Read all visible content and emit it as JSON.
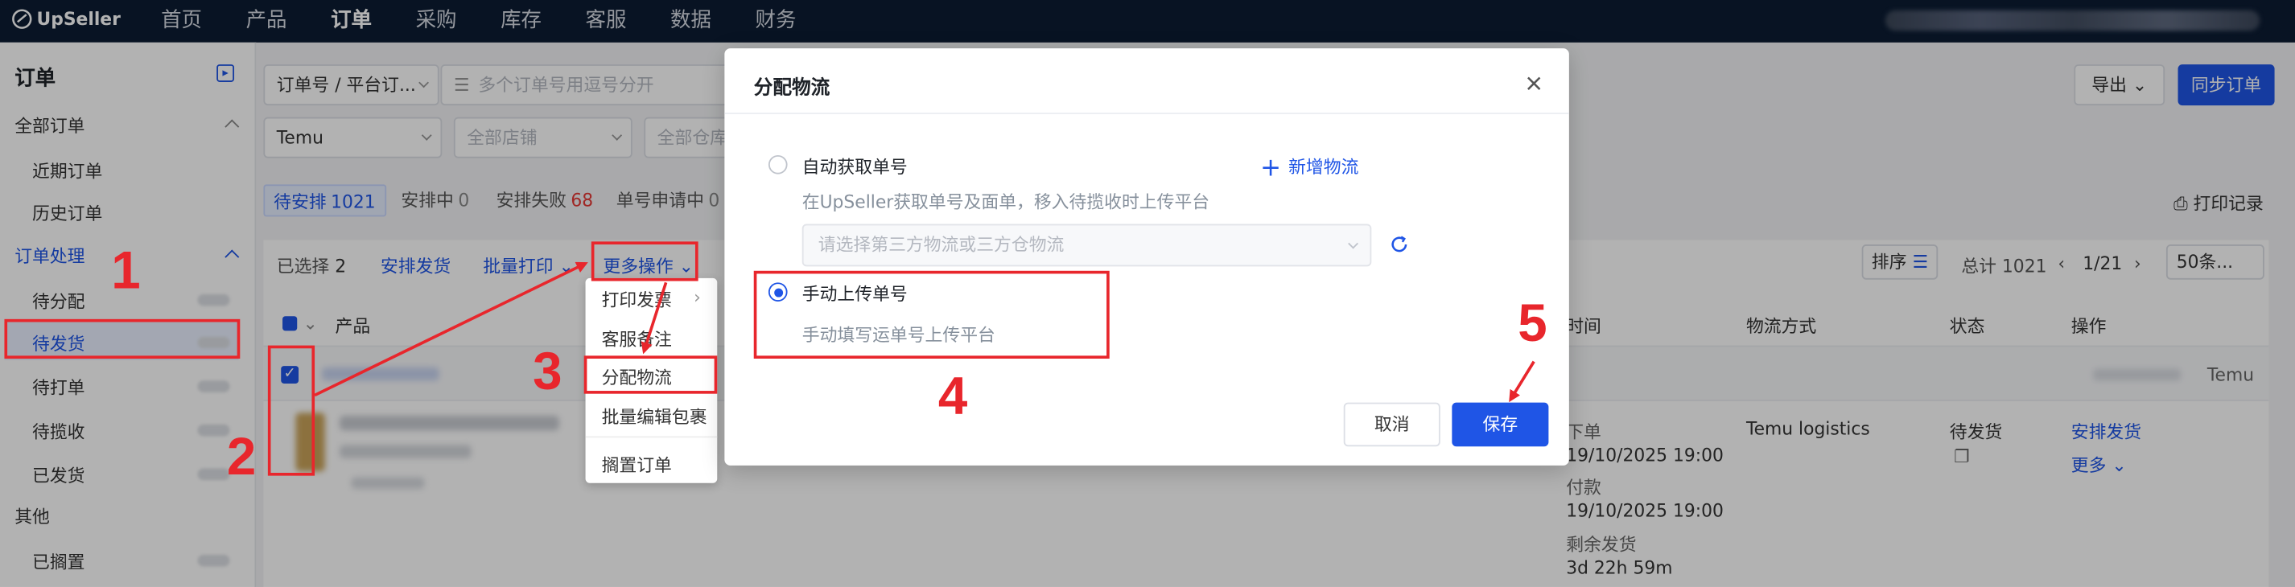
{
  "topbar": {
    "logo": "UpSeller",
    "nav": [
      "首页",
      "产品",
      "订单",
      "采购",
      "库存",
      "客服",
      "数据",
      "财务"
    ],
    "active_nav": 2
  },
  "sidebar": {
    "title": "订单",
    "groups": [
      {
        "label": "全部订单",
        "items": [
          "近期订单",
          "历史订单"
        ]
      },
      {
        "label": "订单处理",
        "items": [
          "待分配",
          "待发货",
          "待打单",
          "待揽收",
          "已发货"
        ]
      },
      {
        "label": "其他",
        "items": [
          "已搁置"
        ]
      }
    ],
    "active_item": "待发货"
  },
  "filters": {
    "search_type": "订单号 / 平台订...",
    "search_placeholder": "多个订单号用逗号分开",
    "platform": "Temu",
    "store_placeholder": "全部店铺",
    "warehouse_placeholder": "全部仓库"
  },
  "header_buttons": {
    "export": "导出",
    "sync": "同步订单"
  },
  "status_tabs": [
    {
      "label": "待安排",
      "count": "1021"
    },
    {
      "label": "安排中",
      "count": "0"
    },
    {
      "label": "安排失败",
      "count": "68"
    },
    {
      "label": "单号申请中",
      "count": "0"
    }
  ],
  "print_records": "打印记录",
  "toolbar": {
    "selected": "已选择",
    "selected_count": "2",
    "arrange_ship": "安排发货",
    "batch_print": "批量打印",
    "more_actions": "更多操作",
    "sort": "排序",
    "total": "总计 1021",
    "page": "1/21",
    "page_size": "50条..."
  },
  "table": {
    "headers": [
      "产品",
      "时间",
      "物流方式",
      "状态",
      "操作"
    ],
    "row_platform": "Temu",
    "order": {
      "order_label": "下单",
      "order_time": "19/10/2025 19:00",
      "paid_label": "付款",
      "paid_time": "19/10/2025 19:00",
      "remaining_label": "剩余发货",
      "remaining": "3d 22h 59m",
      "logistics": "Temu logistics",
      "status": "待发货",
      "action_arrange": "安排发货",
      "action_more": "更多"
    }
  },
  "dropdown_menu": [
    "打印发票",
    "客服备注",
    "分配物流",
    "批量编辑包裹",
    "搁置订单"
  ],
  "modal": {
    "title": "分配物流",
    "option_auto": "自动获取单号",
    "option_auto_desc": "在UpSeller获取单号及面单，移入待揽收时上传平台",
    "add_logistics": "新增物流",
    "logistics_placeholder": "请选择第三方物流或三方仓物流",
    "option_manual": "手动上传单号",
    "option_manual_desc": "手动填写运单号上传平台",
    "selected_option": "手动上传单号",
    "cancel": "取消",
    "save": "保存"
  },
  "annotations": [
    "1",
    "2",
    "3",
    "4",
    "5"
  ],
  "colors": {
    "brand_blue": "#1f55e6",
    "topbar": "#0c1c33",
    "annotation_red": "#e8262c"
  }
}
